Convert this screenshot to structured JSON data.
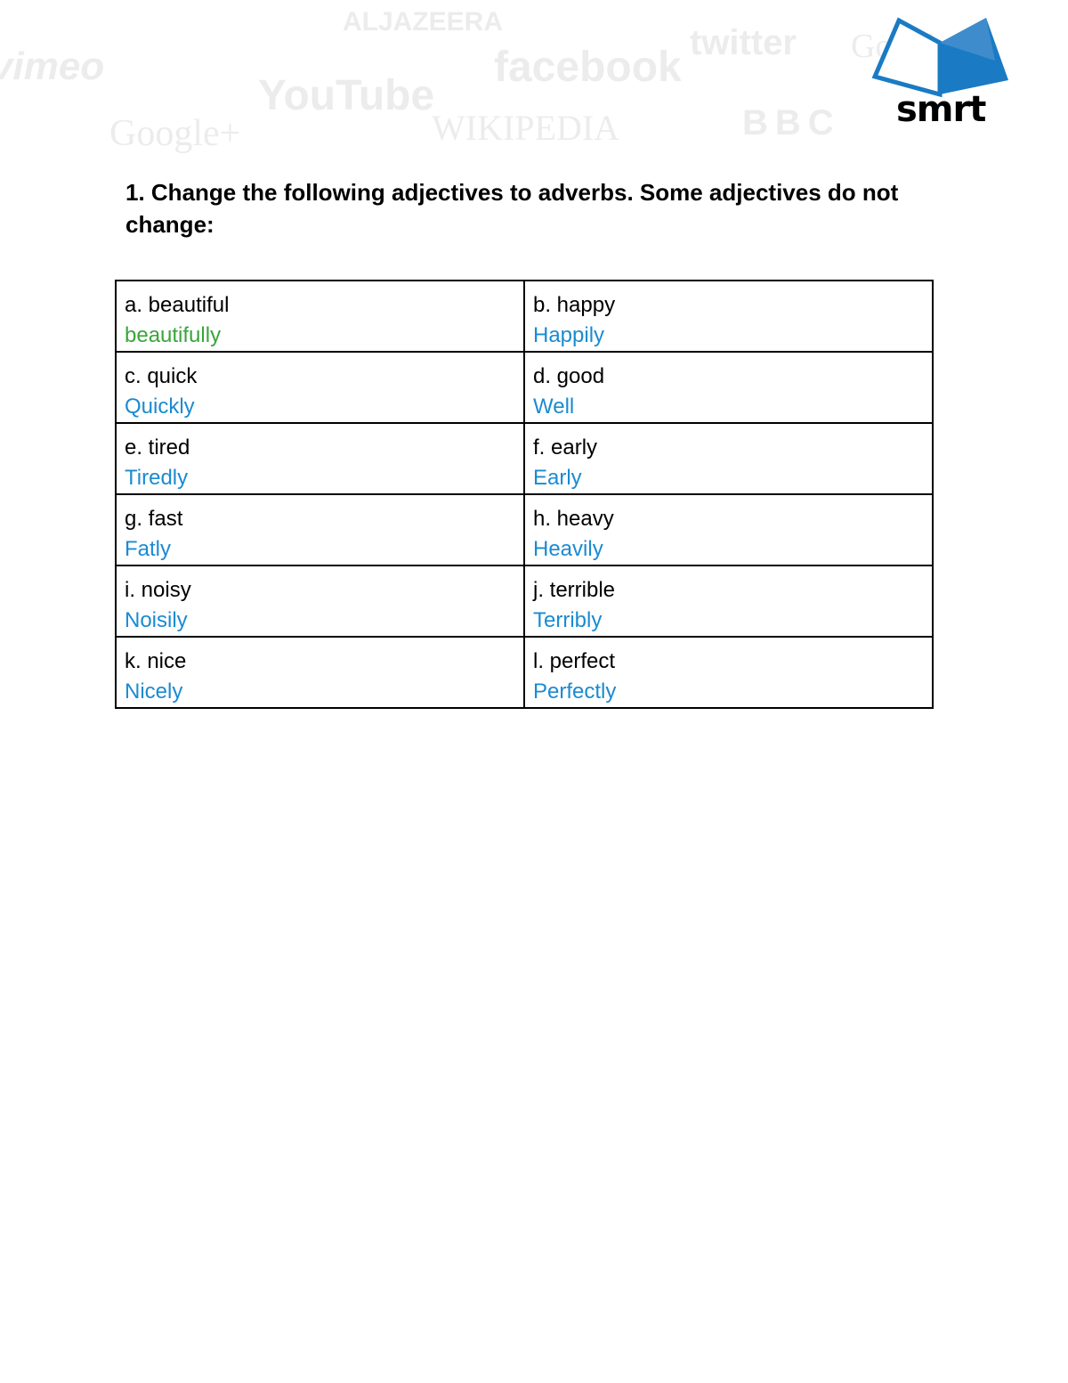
{
  "header": {
    "background_logos": [
      "vimeo",
      "ALJAZEERA",
      "YouTube",
      "facebook",
      "twitter",
      "Google",
      "Google+",
      "WIKIPEDIA",
      "BBC"
    ],
    "brand": {
      "name": "smrt",
      "color": "#1a7bc4"
    }
  },
  "exercise": {
    "title": "1. Change the following adjectives to adverbs. Some adjectives do not change:",
    "answer_color": "#1a8bd1",
    "rows": [
      [
        {
          "prompt": "a. beautiful",
          "answer": "beautifully",
          "answer_color": "#3aa53a"
        },
        {
          "prompt": "b. happy",
          "answer": "Happily"
        }
      ],
      [
        {
          "prompt": "c. quick",
          "answer": "Quickly"
        },
        {
          "prompt": "d. good",
          "answer": "Well"
        }
      ],
      [
        {
          "prompt": "e. tired",
          "answer": "Tiredly"
        },
        {
          "prompt": "f. early",
          "answer": "Early"
        }
      ],
      [
        {
          "prompt": "g. fast",
          "answer": "Fatly"
        },
        {
          "prompt": "h. heavy",
          "answer": "Heavily"
        }
      ],
      [
        {
          "prompt": "i. noisy",
          "answer": "Noisily"
        },
        {
          "prompt": "j. terrible",
          "answer": "Terribly"
        }
      ],
      [
        {
          "prompt": "k. nice",
          "answer": "Nicely"
        },
        {
          "prompt": "l. perfect",
          "answer": "Perfectly"
        }
      ]
    ]
  }
}
